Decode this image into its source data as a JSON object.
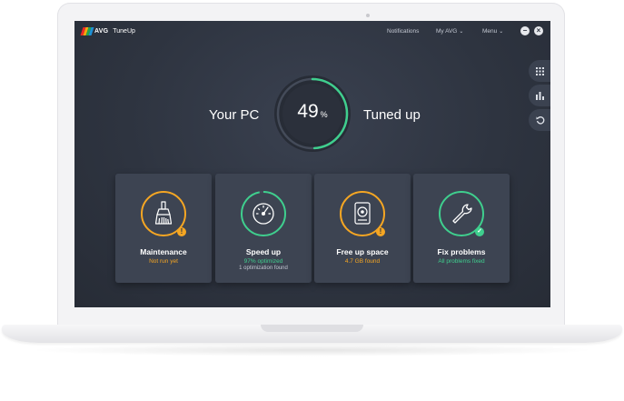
{
  "app": {
    "brand": "AVG",
    "product": "TuneUp",
    "brand_colors": [
      "#ee2a24",
      "#f7a80d",
      "#23a84b",
      "#1e90d6"
    ]
  },
  "topbar": {
    "notifications": "Notifications",
    "my_avg": "My AVG",
    "menu": "Menu",
    "minimize_icon": "−",
    "close_icon": "×"
  },
  "side_buttons": [
    {
      "icon": "grid-icon"
    },
    {
      "icon": "bar-chart-icon"
    },
    {
      "icon": "undo-icon"
    }
  ],
  "status": {
    "left": "Your PC",
    "right": "Tuned up",
    "percent": "49",
    "percent_symbol": "%",
    "progress": 0.49,
    "accent": "#3fcf8e"
  },
  "cards": [
    {
      "title": "Maintenance",
      "subtitle": "Not run yet",
      "subtitle_color": "#f5a623",
      "ring_color": "#f5a623",
      "icon": "broom-icon",
      "badge": "!",
      "badge_color": "#f5a623"
    },
    {
      "title": "Speed up",
      "subtitle": "97% optimized",
      "subtitle_color": "#3fcf8e",
      "detail": "1 optimization found",
      "ring_color": "#3fcf8e",
      "icon": "speedometer-icon",
      "progress": 0.97
    },
    {
      "title": "Free up space",
      "subtitle": "4.7 GB found",
      "subtitle_color": "#f5a623",
      "ring_color": "#f5a623",
      "icon": "hard-drive-icon",
      "badge": "!",
      "badge_color": "#f5a623"
    },
    {
      "title": "Fix problems",
      "subtitle": "All problems fixed",
      "subtitle_color": "#3fcf8e",
      "ring_color": "#3fcf8e",
      "icon": "wrench-icon",
      "badge": "✓",
      "badge_color": "#3fcf8e"
    }
  ]
}
